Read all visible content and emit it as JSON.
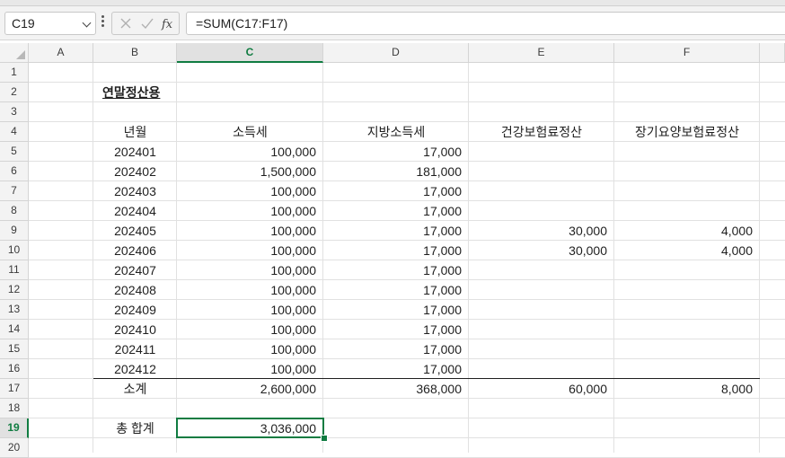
{
  "formula_bar": {
    "name_box": "C19",
    "formula": "=SUM(C17:F17)"
  },
  "columns": [
    "A",
    "B",
    "C",
    "D",
    "E",
    "F"
  ],
  "rows": [
    "1",
    "2",
    "3",
    "4",
    "5",
    "6",
    "7",
    "8",
    "9",
    "10",
    "11",
    "12",
    "13",
    "14",
    "15",
    "16",
    "17",
    "18",
    "19",
    "20"
  ],
  "sheet": {
    "title": "연말정산용",
    "headers": [
      "년월",
      "소득세",
      "지방소득세",
      "건강보험료정산",
      "장기요양보험료정산"
    ],
    "data_rows": [
      [
        "202401",
        "100,000",
        "17,000",
        "",
        ""
      ],
      [
        "202402",
        "1,500,000",
        "181,000",
        "",
        ""
      ],
      [
        "202403",
        "100,000",
        "17,000",
        "",
        ""
      ],
      [
        "202404",
        "100,000",
        "17,000",
        "",
        ""
      ],
      [
        "202405",
        "100,000",
        "17,000",
        "30,000",
        "4,000"
      ],
      [
        "202406",
        "100,000",
        "17,000",
        "30,000",
        "4,000"
      ],
      [
        "202407",
        "100,000",
        "17,000",
        "",
        ""
      ],
      [
        "202408",
        "100,000",
        "17,000",
        "",
        ""
      ],
      [
        "202409",
        "100,000",
        "17,000",
        "",
        ""
      ],
      [
        "202410",
        "100,000",
        "17,000",
        "",
        ""
      ],
      [
        "202411",
        "100,000",
        "17,000",
        "",
        ""
      ],
      [
        "202412",
        "100,000",
        "17,000",
        "",
        ""
      ]
    ],
    "subtotal_row": [
      "소계",
      "2,600,000",
      "368,000",
      "60,000",
      "8,000"
    ],
    "total_row": [
      "총 합계",
      "3,036,000"
    ]
  },
  "colors": {
    "accent": "#107c41",
    "header_bg": "#f3f3f3",
    "gridline": "#e1e1e1"
  }
}
